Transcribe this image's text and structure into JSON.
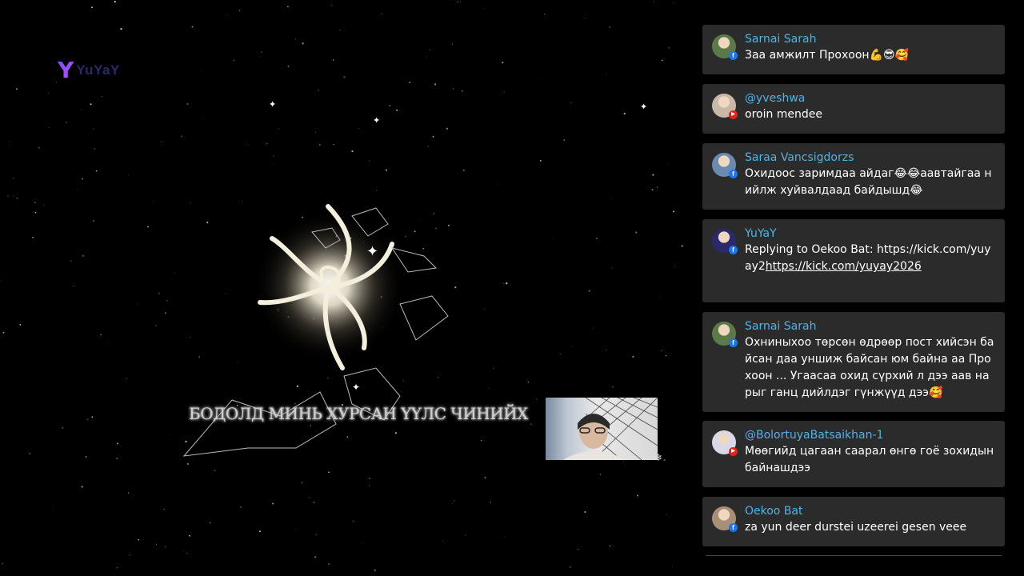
{
  "stream": {
    "logo": {
      "mark": "Y",
      "text": "YuYaY"
    },
    "lyric": "БОДОЛД МИНЬ ХУРСАН ҮҮЛС ЧИНИЙХ"
  },
  "chat": [
    {
      "name": "Sarnai Sarah",
      "platform": "facebook",
      "text": "Заа амжилт Прохоон💪😎🥰",
      "avatar_color": "#5a7a4a"
    },
    {
      "name": "@yveshwa",
      "platform": "youtube",
      "text": "oroin mendee",
      "avatar_color": "#c8b8a8"
    },
    {
      "name": "Saraa Vancsigdorzs",
      "platform": "facebook",
      "text": "Охидоос заримдаа айдаг😂😂аавтайгаа нийлж хуйвалдаад байдышд😂",
      "avatar_color": "#6a8ab0"
    },
    {
      "name": "YuYaY",
      "platform": "facebook",
      "text_prefix": "Replying to Oekoo Bat: https://kick.com/yuyay2",
      "link": "https://kick.com/yuyay2026",
      "avatar_color": "#2a2a6a"
    },
    {
      "name": "Sarnai Sarah",
      "platform": "facebook",
      "text": "Охниныхоо төрсөн өдрөөр пост хийсэн байсан даа уншиж байсан юм байна аа Прохоон ... Угаасаа охид сүрхий л дээ аав нарыг ганц дийлдэг гүнжүүд дээ🥰",
      "avatar_color": "#5a7a4a"
    },
    {
      "name": "@BolortuyaBatsaikhan-1",
      "platform": "youtube",
      "text": "Мөөгийд цагаан саарал өнгө гоё зохидын байнашдээ",
      "avatar_color": "#d8d8e8"
    },
    {
      "name": "Oekoo Bat",
      "platform": "facebook",
      "text": "za yun deer durstei uzeerei gesen veee",
      "avatar_color": "#a89078"
    }
  ],
  "badges": {
    "facebook": "f",
    "youtube": "▶"
  }
}
